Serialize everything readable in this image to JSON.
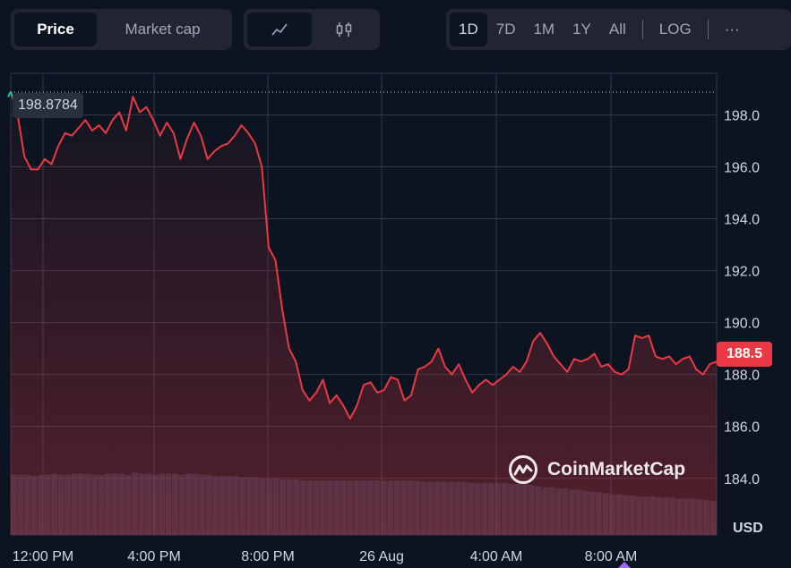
{
  "toolbar": {
    "chart_type_tabs": [
      "Price",
      "Market cap"
    ],
    "active_chart_type": "Price",
    "mode_icons": [
      "line-chart-icon",
      "candlestick-icon"
    ],
    "range_tabs": [
      "1D",
      "7D",
      "1M",
      "1Y",
      "All"
    ],
    "active_range": "1D",
    "log_label": "LOG",
    "more_label": "···"
  },
  "chart_data": {
    "type": "line",
    "title": "",
    "currency": "USD",
    "ylim": [
      183.2,
      199.6
    ],
    "y_ticks": [
      "198.0",
      "196.0",
      "194.0",
      "192.0",
      "190.0",
      "188.0",
      "186.0",
      "184.0"
    ],
    "x_ticks": [
      "12:00 PM",
      "4:00 PM",
      "8:00 PM",
      "26 Aug",
      "4:00 AM",
      "8:00 AM"
    ],
    "high_value": "198.8784",
    "current_value": "188.5",
    "line_color": "#ea3943",
    "series": [
      {
        "values": [
          198.9,
          198.0,
          196.4,
          195.9,
          195.9,
          196.3,
          196.1,
          196.8,
          197.3,
          197.2,
          197.5,
          197.8,
          197.4,
          197.6,
          197.3,
          197.8,
          198.1,
          197.4,
          198.7,
          198.1,
          198.3,
          197.8,
          197.2,
          197.7,
          197.3,
          196.3,
          197.1,
          197.7,
          197.2,
          196.3,
          196.6,
          196.8,
          196.9,
          197.2,
          197.6,
          197.3,
          196.9,
          196.0,
          192.9,
          192.4,
          190.5,
          189.0,
          188.5,
          187.4,
          187.0,
          187.3,
          187.8,
          186.9,
          187.2,
          186.8,
          186.3,
          186.8,
          187.6,
          187.7,
          187.3,
          187.4,
          187.9,
          187.8,
          187.0,
          187.2,
          188.2,
          188.3,
          188.5,
          189.0,
          188.3,
          188.0,
          188.4,
          187.8,
          187.3,
          187.6,
          187.8,
          187.6,
          187.8,
          188.0,
          188.3,
          188.1,
          188.5,
          189.3,
          189.6,
          189.2,
          188.7,
          188.4,
          188.1,
          188.6,
          188.5,
          188.6,
          188.8,
          188.3,
          188.4,
          188.1,
          188.0,
          188.2,
          189.5,
          189.4,
          189.5,
          188.7,
          188.6,
          188.7,
          188.4,
          188.6,
          188.7,
          188.2,
          188.0,
          188.4,
          188.5
        ]
      }
    ],
    "volume": [
      0.53,
      0.53,
      0.53,
      0.52,
      0.53,
      0.53,
      0.54,
      0.53,
      0.53,
      0.54,
      0.54,
      0.54,
      0.53,
      0.53,
      0.54,
      0.54,
      0.54,
      0.53,
      0.55,
      0.54,
      0.54,
      0.53,
      0.54,
      0.54,
      0.54,
      0.53,
      0.54,
      0.54,
      0.53,
      0.53,
      0.52,
      0.52,
      0.52,
      0.52,
      0.51,
      0.51,
      0.51,
      0.5,
      0.5,
      0.5,
      0.49,
      0.49,
      0.49,
      0.48,
      0.48,
      0.48,
      0.48,
      0.48,
      0.48,
      0.48,
      0.48,
      0.48,
      0.48,
      0.48,
      0.48,
      0.48,
      0.48,
      0.48,
      0.48,
      0.48,
      0.48,
      0.47,
      0.47,
      0.47,
      0.47,
      0.47,
      0.47,
      0.47,
      0.46,
      0.46,
      0.46,
      0.46,
      0.46,
      0.46,
      0.45,
      0.45,
      0.45,
      0.44,
      0.43,
      0.42,
      0.42,
      0.41,
      0.41,
      0.4,
      0.4,
      0.39,
      0.38,
      0.38,
      0.37,
      0.36,
      0.36,
      0.35,
      0.35,
      0.34,
      0.34,
      0.34,
      0.33,
      0.33,
      0.33,
      0.32,
      0.32,
      0.32,
      0.31,
      0.31,
      0.3
    ],
    "grid": true
  },
  "watermark": {
    "label": "CoinMarketCap"
  },
  "colors": {
    "background": "#0d1421",
    "panel": "#222531",
    "down": "#ea3943",
    "up": "#16c784",
    "grid": "#323546"
  }
}
